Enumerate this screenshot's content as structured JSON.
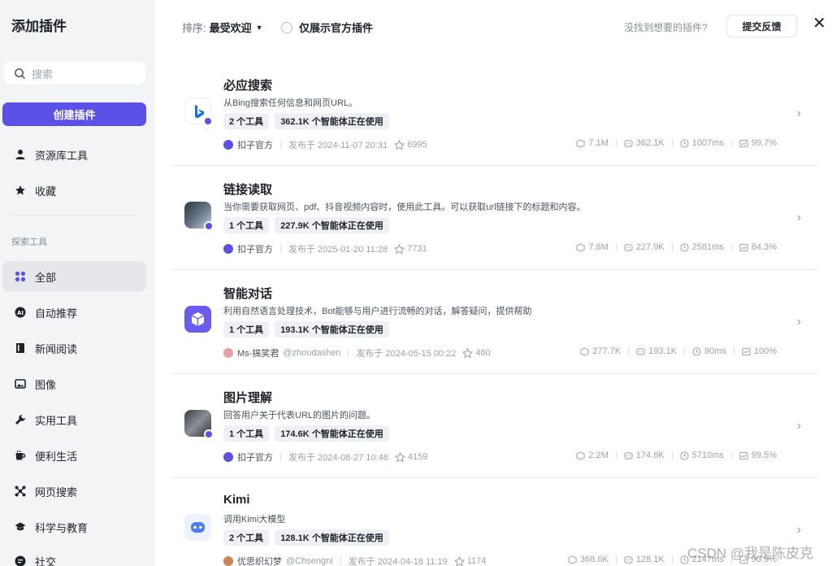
{
  "sidebar": {
    "title": "添加插件",
    "search_placeholder": "搜索",
    "create_label": "创建插件",
    "top_items": [
      {
        "label": "资源库工具",
        "icon": "person-icon"
      },
      {
        "label": "收藏",
        "icon": "star-icon"
      }
    ],
    "section_label": "探索工具",
    "categories": [
      {
        "label": "全部",
        "icon": "grid-icon",
        "active": true
      },
      {
        "label": "自动推荐",
        "icon": "ai-icon"
      },
      {
        "label": "新闻阅读",
        "icon": "book-icon"
      },
      {
        "label": "图像",
        "icon": "image-icon"
      },
      {
        "label": "实用工具",
        "icon": "wrench-icon"
      },
      {
        "label": "便利生活",
        "icon": "cup-icon"
      },
      {
        "label": "网页搜索",
        "icon": "web-icon"
      },
      {
        "label": "科学与教育",
        "icon": "education-icon"
      },
      {
        "label": "社交",
        "icon": "chat-icon"
      }
    ]
  },
  "topbar": {
    "sort_label": "排序:",
    "sort_value": "最受欢迎",
    "official_only_label": "仅展示官方插件",
    "not_found_text": "没找到想要的插件?",
    "feedback_label": "提交反馈"
  },
  "plugins": [
    {
      "name": "必应搜索",
      "description": "从Bing搜索任何信息和网页URL。",
      "tools": "2 个工具",
      "users": "362.1K 个智能体正在使用",
      "author": "扣子官方",
      "handle": "",
      "published": "发布于 2024-11-07 20:31",
      "stars": "6995",
      "calls": "7.1M",
      "bots": "362.1K",
      "latency": "1007ms",
      "success": "99.7%"
    },
    {
      "name": "链接读取",
      "description": "当你需要获取网页、pdf、抖音视频内容时，使用此工具。可以获取url链接下的标题和内容。",
      "tools": "1 个工具",
      "users": "227.9K 个智能体正在使用",
      "author": "扣子官方",
      "handle": "",
      "published": "发布于 2025-01-20 11:28",
      "stars": "7731",
      "calls": "7.8M",
      "bots": "227.9K",
      "latency": "2581ms",
      "success": "84.3%"
    },
    {
      "name": "智能对话",
      "description": "利用自然语言处理技术，Bot能够与用户进行流畅的对话，解答疑问，提供帮助",
      "tools": "1 个工具",
      "users": "193.1K 个智能体正在使用",
      "author": "Ms-搞笑君",
      "handle": "@zhoudashen",
      "published": "发布于 2024-05-15 00:22",
      "stars": "460",
      "calls": "277.7K",
      "bots": "193.1K",
      "latency": "90ms",
      "success": "100%"
    },
    {
      "name": "图片理解",
      "description": "回答用户关于代表URL的图片的问题。",
      "tools": "1 个工具",
      "users": "174.6K 个智能体正在使用",
      "author": "扣子官方",
      "handle": "",
      "published": "发布于 2024-08-27 10:46",
      "stars": "4159",
      "calls": "2.2M",
      "bots": "174.6K",
      "latency": "5710ms",
      "success": "99.5%"
    },
    {
      "name": "Kimi",
      "description": "调用Kimi大模型",
      "tools": "2 个工具",
      "users": "128.1K 个智能体正在使用",
      "author": "优思织幻梦",
      "handle": "@Chsengni",
      "published": "发布于 2024-04-18 11:19",
      "stars": "1174",
      "calls": "368.6K",
      "bots": "128.1K",
      "latency": "2147ms",
      "success": "90.9%"
    }
  ],
  "watermark": "CSDN @我是陈皮克",
  "colors": {
    "accent": "#5b51e8",
    "sidebar_bg": "#f3f4f6"
  }
}
